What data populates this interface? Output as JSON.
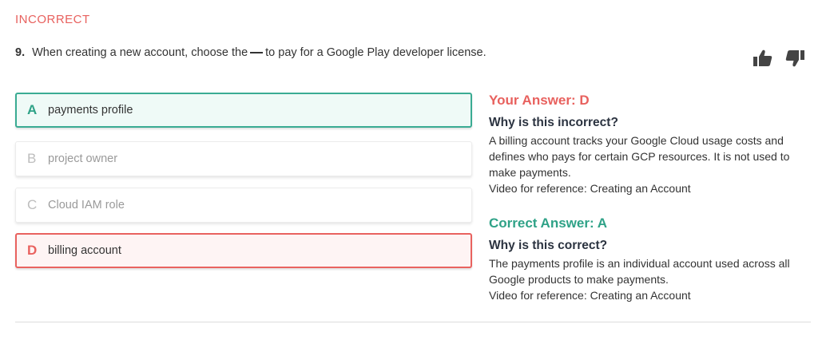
{
  "status_label": "INCORRECT",
  "question": {
    "number": "9.",
    "text_before": "When creating a new account, choose the",
    "text_after": "to pay for a Google Play developer license."
  },
  "feedback": {
    "thumbs_up_icon": "thumbs-up-icon",
    "thumbs_down_icon": "thumbs-down-icon"
  },
  "options": [
    {
      "letter": "A",
      "text": "payments profile",
      "state": "correct"
    },
    {
      "letter": "B",
      "text": "project owner",
      "state": "neutral"
    },
    {
      "letter": "C",
      "text": "Cloud IAM role",
      "state": "neutral"
    },
    {
      "letter": "D",
      "text": "billing account",
      "state": "selected-incorrect"
    }
  ],
  "your_answer": {
    "heading": "Your Answer: D",
    "why_title": "Why is this incorrect?",
    "explanation": "A billing account tracks your Google Cloud usage costs and defines who pays for certain GCP resources. It is not used to make payments.",
    "reference": "Video for reference: Creating an Account"
  },
  "correct_answer": {
    "heading": "Correct Answer: A",
    "why_title": "Why is this correct?",
    "explanation": "The payments profile is an individual account used across all Google products to make payments.",
    "reference": "Video for reference: Creating an Account"
  },
  "colors": {
    "incorrect": "#e8615e",
    "correct": "#2fa287",
    "correct_bg": "#effaf7",
    "incorrect_bg": "#fef4f4"
  }
}
